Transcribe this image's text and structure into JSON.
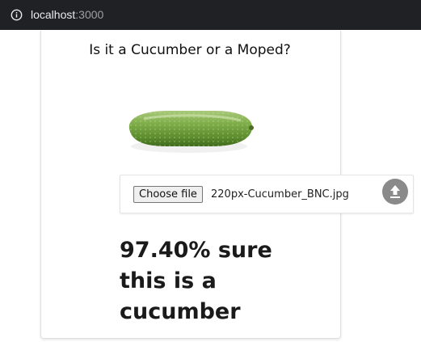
{
  "browser": {
    "url_host": "localhost",
    "url_port": ":3000",
    "icon": "info-icon"
  },
  "app": {
    "title": "Is it a Cucumber or a Moped?",
    "image_subject": "cucumber",
    "upload": {
      "choose_label": "Choose file",
      "file_name": "220px-Cucumber_BNC.jpg",
      "upload_icon": "upload-icon"
    },
    "result_text": "97.40% sure this is a cucumber"
  },
  "colors": {
    "topbar": "#202124",
    "upload_button": "#8a8a8a",
    "cucumber": "#6b9a3a"
  }
}
